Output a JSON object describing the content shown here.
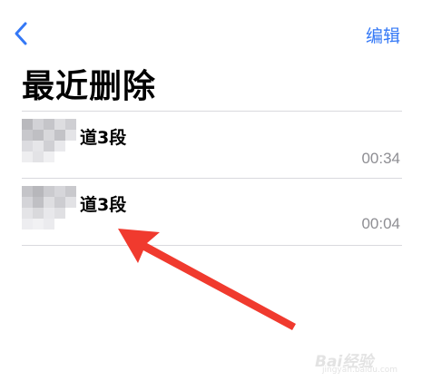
{
  "nav": {
    "back_icon": "chevron-left-icon",
    "edit_label": "编辑"
  },
  "title": "最近删除",
  "recordings": [
    {
      "title": "道3段",
      "duration": "00:34"
    },
    {
      "title": "道3段",
      "duration": "00:04"
    }
  ],
  "annotation": {
    "arrow_color": "#f03a2e",
    "arrow_icon": "red-pointer-arrow"
  },
  "watermark": {
    "text": "Bai经验",
    "subtext": "jingyan.baidu.com"
  },
  "colors": {
    "accent": "#3478f6",
    "secondary_text": "#8e8e93",
    "divider": "#d9d9de"
  }
}
